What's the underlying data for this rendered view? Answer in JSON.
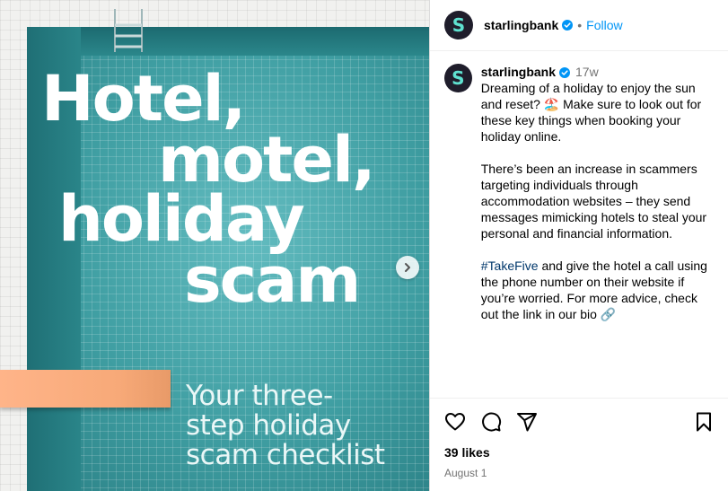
{
  "post": {
    "headline": [
      "Hotel,",
      "motel,",
      "holiday",
      "scam"
    ],
    "subhead": [
      "Your three-",
      "step holiday",
      "scam checklist"
    ]
  },
  "header": {
    "username": "starlingbank",
    "separator": "•",
    "follow_label": "Follow",
    "avatar_letter": "S"
  },
  "caption": {
    "username": "starlingbank",
    "time": "17w",
    "paragraphs": [
      "Dreaming of a holiday to enjoy the sun and reset? 🏖️  Make sure to look out for these key things when booking your holiday online.",
      "There’s been an increase in scammers targeting individuals through accommodation websites – they send messages mimicking hotels to steal your personal and financial information."
    ],
    "hashtag": "#TakeFive",
    "last_paragraph": " and give the hotel a call using the phone number on their website if you’re worried. For more advice, check out the link in our bio 🔗"
  },
  "footer": {
    "likes": "39 likes",
    "date": "August 1"
  },
  "colors": {
    "accent": "#0095f6",
    "avatar_bg": "#1f1d2b",
    "avatar_letter": "#5fe1d0",
    "pool": "#2f8f93",
    "board": "#f7a978"
  },
  "icons": [
    "chevron-right-icon",
    "verified-icon",
    "heart-icon",
    "comment-icon",
    "share-icon",
    "bookmark-icon"
  ]
}
